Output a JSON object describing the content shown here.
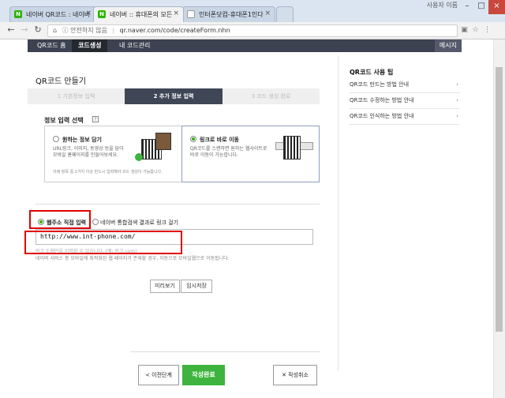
{
  "browser": {
    "tabs": [
      {
        "label": "네이버 QR코드 : 네이버"
      },
      {
        "label": "네이버 :: 휴대폰의 모든"
      },
      {
        "label": "인터폰닷컴-휴대폰1인다"
      }
    ],
    "user_label": "사용자 이름 ",
    "security_label": "안전하지 않음",
    "url": "qr.naver.com/code/createForm.nhn"
  },
  "site_nav": {
    "items": [
      "QR코드 홈",
      "코드생성",
      "내 코드관리"
    ],
    "message": "메시지"
  },
  "main": {
    "title": "QR코드 만들기",
    "steps": [
      "1 기본정보 입력",
      "2 추가 정보 입력",
      "3 코드 생성 완료"
    ],
    "section_label": "정보 입력 선택",
    "help": "?",
    "card1": {
      "title": "원하는 정보 담기",
      "desc1": "URL링크, 이미지, 동영상 등을 담아",
      "desc2": "모바일 홈페이지를 만들어보세요.",
      "note": "아래 항목 중 1가지 이상 반드시 입력해야 코드 생성이 가능합니다."
    },
    "card2": {
      "title": "링크로 바로 이동",
      "desc1": "QR코드를 스캔하면 원하는 웹사이트로",
      "desc2": "바로 이동이 가능합니다."
    },
    "radio1_label": "웹주소 직접 입력",
    "radio2_label": "네이버 통합검색 결과로 링크 걸기",
    "url_value": "http://www.int-phone.com/",
    "hint1": "링크 도메인을 입력할 수 있습니다. (예: 링크.com)",
    "hint2": "네이버 서비스 중 모바일에 최적화된 웹 페이지가 존재할 경우, 자동으로 모바일웹으로 이동됩니다.",
    "preview_button": "미리보기",
    "save_temp_button": "임시저장",
    "prev_button": "< 이전단계",
    "done_button": "작성완료",
    "cancel_button": "✕ 작성취소"
  },
  "side": {
    "title": "QR코드 사용 팁",
    "items": [
      "QR코드 만드는 방법 안내",
      "QR코드 수정하는 방법 안내",
      "QR코드 인식하는 방법 안내"
    ]
  },
  "colors": {
    "accent": "#2db400",
    "nav": "#3c4250",
    "highlight": "#e00000"
  }
}
